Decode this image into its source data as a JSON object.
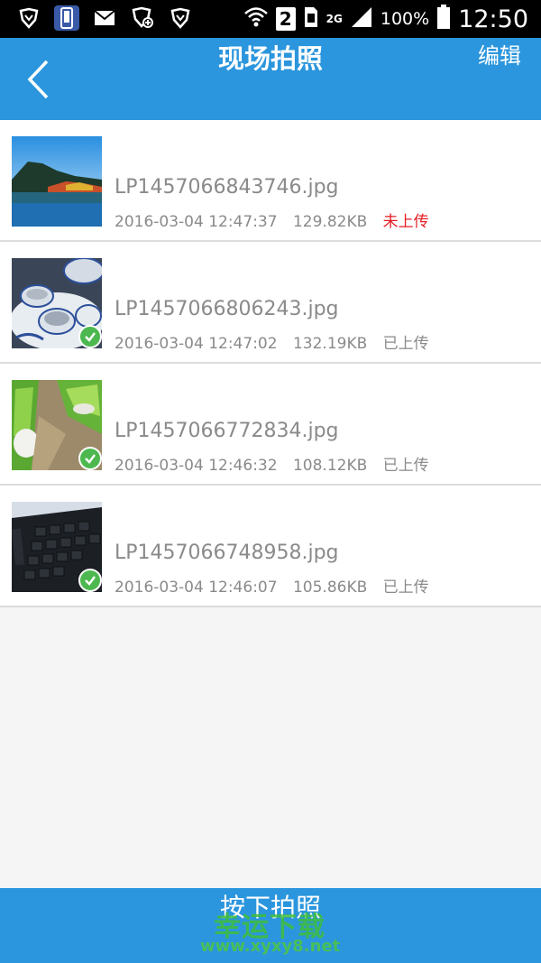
{
  "status_bar": {
    "sim_slot": "2",
    "network": "2G",
    "battery": "100%",
    "time": "12:50",
    "icons": [
      "shield-icon",
      "phone-icon",
      "mail-icon",
      "shield-add-icon",
      "shield-icon",
      "wifi-icon",
      "sim-icon",
      "signal-icon",
      "battery-icon"
    ]
  },
  "header": {
    "title": "现场拍照",
    "edit_label": "编辑",
    "back_icon": "chevron-left-icon",
    "color": "#2b96dd"
  },
  "photos": [
    {
      "filename": "LP1457066843746.jpg",
      "datetime": "2016-03-04 12:47:37",
      "size": "129.82KB",
      "status": "未上传",
      "uploaded": false,
      "thumb": "lake-landscape"
    },
    {
      "filename": "LP1457066806243.jpg",
      "datetime": "2016-03-04 12:47:02",
      "size": "132.19KB",
      "status": "已上传",
      "uploaded": true,
      "thumb": "porcelain-bowls"
    },
    {
      "filename": "LP1457066772834.jpg",
      "datetime": "2016-03-04 12:46:32",
      "size": "108.12KB",
      "status": "已上传",
      "uploaded": true,
      "thumb": "green-cans"
    },
    {
      "filename": "LP1457066748958.jpg",
      "datetime": "2016-03-04 12:46:07",
      "size": "105.86KB",
      "status": "已上传",
      "uploaded": true,
      "thumb": "keyboard"
    }
  ],
  "bottom": {
    "shoot_label": "按下拍照"
  },
  "watermark": {
    "line1": "幸运下载",
    "line2": "www.xyxy8.net"
  },
  "colors": {
    "accent": "#2b96dd",
    "not_uploaded": "#e51c23",
    "uploaded_check": "#4cb84f"
  }
}
